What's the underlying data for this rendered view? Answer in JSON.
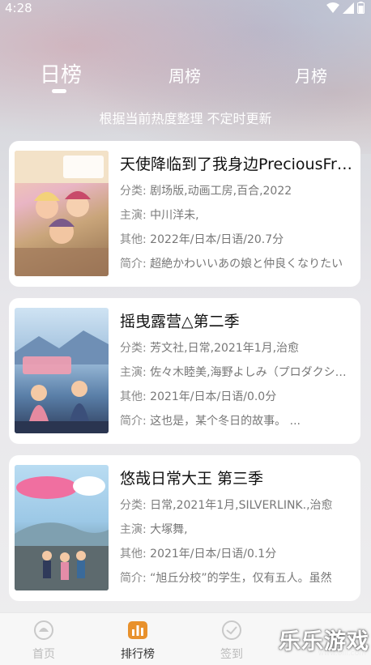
{
  "status_bar": {
    "time": "4:28"
  },
  "tabs": [
    {
      "label": "日榜",
      "active": true
    },
    {
      "label": "周榜",
      "active": false
    },
    {
      "label": "月榜",
      "active": false
    }
  ],
  "subtitle": "根据当前热度整理 不定时更新",
  "items": [
    {
      "title": "天使降临到了我身边PreciousFriends",
      "category_label": "分类:",
      "category": "剧场版,动画工房,百合,2022",
      "cast_label": "主演:",
      "cast": "中川洋未,",
      "other_label": "其他:",
      "other": "2022年/日本/日语/20.7分",
      "intro_label": "简介:",
      "intro": "超絶かわいいあの娘と仲良くなりたい"
    },
    {
      "title": "摇曳露营△第二季",
      "category_label": "分类:",
      "category": "芳文社,日常,2021年1月,治愈",
      "cast_label": "主演:",
      "cast": "佐々木睦美,海野よしみ（プロダクション）",
      "other_label": "其他:",
      "other": "2021年/日本/日语/0.0分",
      "intro_label": "简介:",
      "intro": "这也是，某个冬日的故事。 ..."
    },
    {
      "title": "悠哉日常大王 第三季",
      "category_label": "分类:",
      "category": "日常,2021年1月,SILVERLINK.,治愈",
      "cast_label": "主演:",
      "cast": "大塚舞,",
      "other_label": "其他:",
      "other": "2021年/日本/日语/0.1分",
      "intro_label": "简介:",
      "intro": "“旭丘分校”的学生，仅有五人。虽然"
    }
  ],
  "bottom_nav": [
    {
      "label": "首页",
      "icon": "home-icon",
      "active": false
    },
    {
      "label": "排行榜",
      "icon": "ranking-icon",
      "active": true
    },
    {
      "label": "签到",
      "icon": "checkin-icon",
      "active": false
    }
  ],
  "watermark": {
    "text": "乐乐游戏",
    "url": "www.6lll.com"
  },
  "colors": {
    "accent": "#e8912c",
    "card_bg": "#ffffff"
  }
}
